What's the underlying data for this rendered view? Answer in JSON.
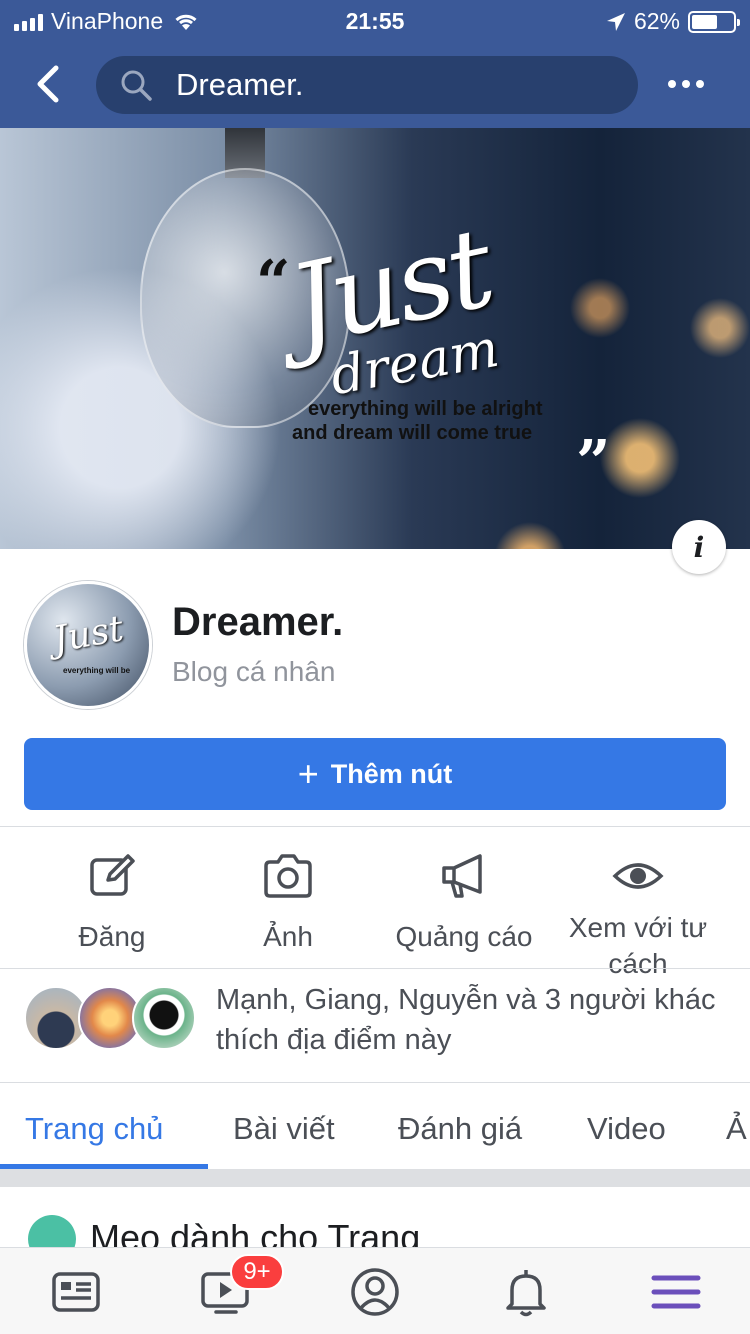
{
  "status_bar": {
    "carrier": "VinaPhone",
    "time": "21:55",
    "battery": "62%",
    "battery_level": 0.62,
    "icons": [
      "signal-icon",
      "wifi-icon",
      "location-arrow-icon",
      "battery-icon"
    ]
  },
  "header": {
    "back_icon": "chevron-left-icon",
    "search_icon": "search-icon",
    "search_text": "Dreamer.",
    "more_icon": "more-horizontal-icon",
    "background": "#3b5998"
  },
  "cover": {
    "quote_open": "“",
    "script_title": "Just",
    "script_sub": "dream",
    "line1": "everything will be alright",
    "line2": "and dream will come true",
    "quote_close": "”",
    "info_icon": "info-icon",
    "info_glyph": "i"
  },
  "profile": {
    "name": "Dreamer.",
    "category": "Blog cá nhân",
    "avatar_text": "Just",
    "avatar_small": "everything will be"
  },
  "add_button": {
    "plus": "+",
    "label": "Thêm nút",
    "color": "#3578e5"
  },
  "actions": [
    {
      "icon": "edit-icon",
      "label": "Đăng"
    },
    {
      "icon": "camera-icon",
      "label": "Ảnh"
    },
    {
      "icon": "megaphone-icon",
      "label": "Quảng cáo"
    },
    {
      "icon": "eye-icon",
      "label": "Xem với tư cách"
    }
  ],
  "likers": {
    "text": "Mạnh, Giang, Nguyễn và 3 người khác thích địa điểm này"
  },
  "tabs": [
    {
      "label": "Trang chủ",
      "active": true
    },
    {
      "label": "Bài viết"
    },
    {
      "label": "Đánh giá"
    },
    {
      "label": "Video"
    },
    {
      "label": "Ả"
    }
  ],
  "tips": {
    "title": "Mẹo dành cho Trang",
    "icon": "graduation-cap-icon"
  },
  "bottom_nav": {
    "items": [
      "news-feed-icon",
      "video-icon",
      "profile-icon",
      "notifications-icon",
      "menu-icon"
    ],
    "video_badge": "9+",
    "menu_color": "#6b4fbb"
  }
}
